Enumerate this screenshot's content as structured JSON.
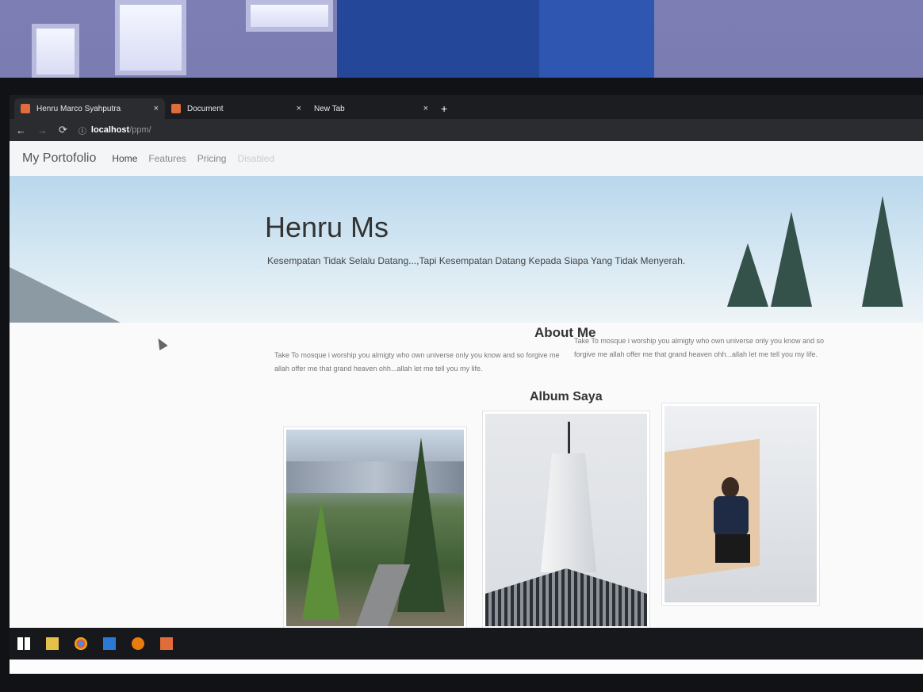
{
  "browser": {
    "tabs": [
      {
        "label": "Henru Marco Syahputra"
      },
      {
        "label": "Document"
      },
      {
        "label": "New Tab"
      }
    ],
    "close_glyph": "×",
    "new_tab_glyph": "+",
    "url_host": "localhost",
    "url_path": "/ppm/"
  },
  "navbar": {
    "brand": "My Portofolio",
    "links": [
      {
        "label": "Home"
      },
      {
        "label": "Features"
      },
      {
        "label": "Pricing"
      },
      {
        "label": "Disabled"
      }
    ]
  },
  "hero": {
    "title": "Henru Ms",
    "subtitle": "Kesempatan Tidak Selalu Datang...,Tapi Kesempatan Datang Kepada Siapa Yang Tidak Menyerah."
  },
  "about": {
    "title": "About Me",
    "col1": "Take To mosque i worship you almigty who own universe only you know and so forgive me allah offer me that grand heaven ohh...allah let me tell you my life.",
    "col2": "Take To mosque i worship you almigty who own universe only you know and so forgive me allah offer me that grand heaven ohh...allah let me tell you my life."
  },
  "album": {
    "title": "Album Saya",
    "photos": [
      {
        "icon": "forest-road-photo"
      },
      {
        "icon": "tower-building-photo"
      },
      {
        "icon": "portrait-person-photo"
      }
    ]
  },
  "colors": {
    "favicon": "#e06c3b",
    "chrome_dark": "#1c1d20",
    "hero_sky": "#b9d7ec"
  }
}
